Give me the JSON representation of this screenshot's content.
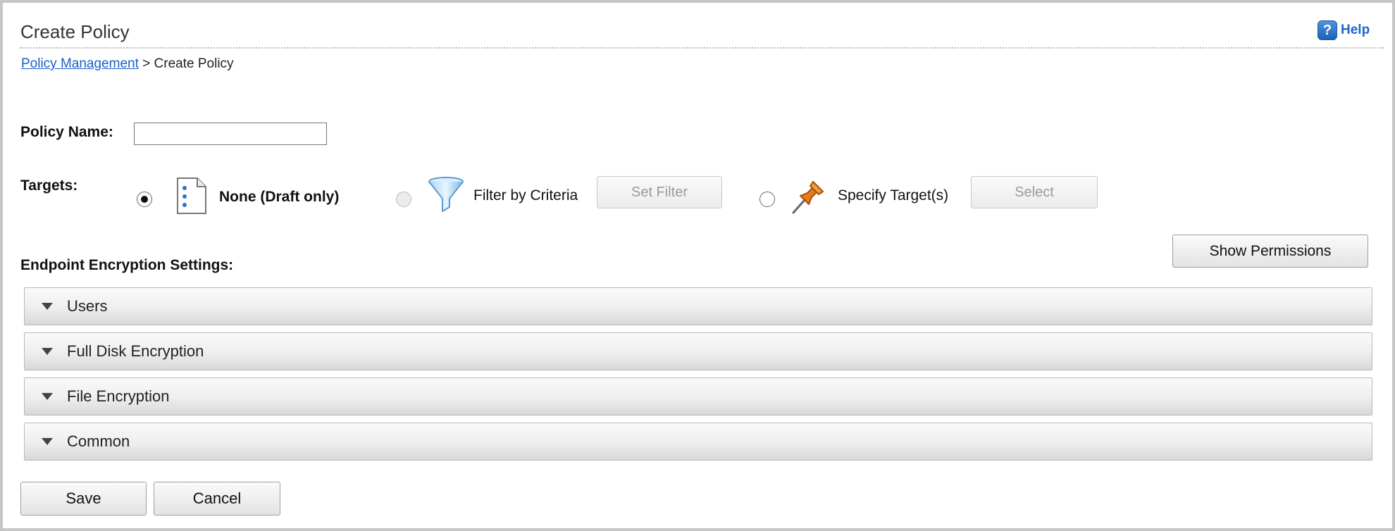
{
  "header": {
    "title": "Create Policy",
    "help_label": "Help",
    "help_icon_glyph": "?"
  },
  "breadcrumb": {
    "link": "Policy Management",
    "separator": ">",
    "current": "Create Policy"
  },
  "form": {
    "policy_name_label": "Policy Name:",
    "policy_name_value": "",
    "targets_label": "Targets:",
    "targets": [
      {
        "label": "None (Draft only)",
        "selected": true,
        "enabled": true,
        "icon": "document-icon"
      },
      {
        "label": "Filter by Criteria",
        "selected": false,
        "enabled": false,
        "icon": "funnel-icon",
        "button": "Set Filter"
      },
      {
        "label": "Specify Target(s)",
        "selected": false,
        "enabled": true,
        "icon": "pushpin-icon",
        "button": "Select"
      }
    ]
  },
  "settings": {
    "label": "Endpoint Encryption Settings:",
    "show_permissions": "Show Permissions",
    "sections": [
      "Users",
      "Full Disk Encryption",
      "File Encryption",
      "Common"
    ]
  },
  "footer": {
    "save": "Save",
    "cancel": "Cancel"
  },
  "colors": {
    "link": "#1a5fc8",
    "help_icon": "#2a74cc",
    "pin": "#e87b1c"
  }
}
